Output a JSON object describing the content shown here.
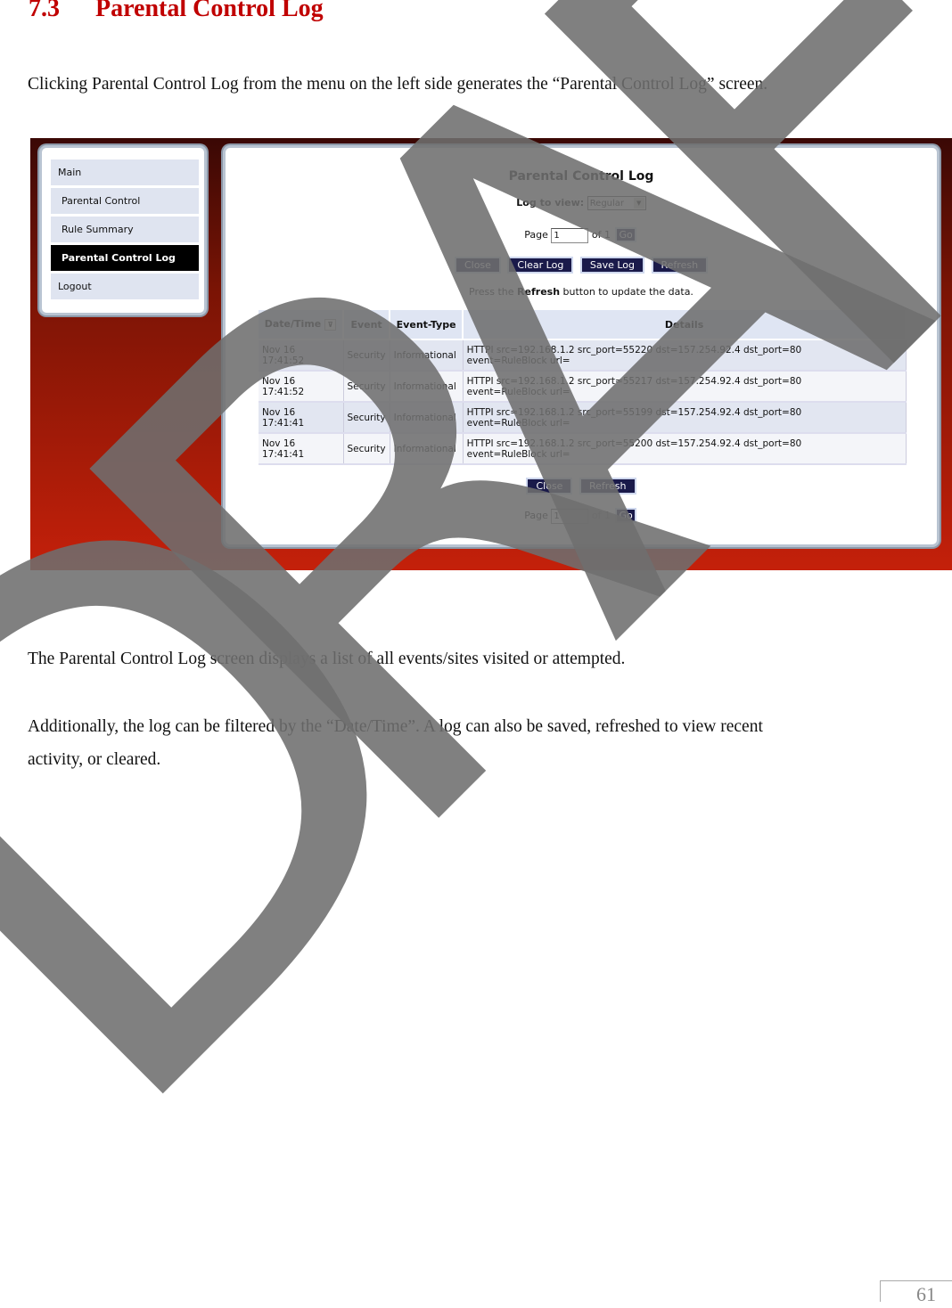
{
  "section": {
    "number": "7.3",
    "title": "Parental Control Log"
  },
  "intro": "Clicking Parental Control Log from the menu on the left side generates the “Parental Control Log” screen.",
  "screenshot": {
    "sidebar": {
      "items": [
        {
          "label": "Main",
          "active": false
        },
        {
          "label": "Parental Control",
          "active": false
        },
        {
          "label": "Rule Summary",
          "active": false
        },
        {
          "label": "Parental Control Log",
          "active": true
        },
        {
          "label": "Logout",
          "active": false
        }
      ]
    },
    "title": "Parental Control Log",
    "log_to_view_label": "Log to view:",
    "log_to_view_value": "Regular",
    "page_label": "Page",
    "page_value": "1",
    "of_label": "of 1",
    "go_label": "Go",
    "buttons": {
      "close": "Close",
      "clear": "Clear Log",
      "save": "Save Log",
      "refresh": "Refresh"
    },
    "hint": {
      "pre": "Press the",
      "bold": "Refresh",
      "post": "button to update the data."
    },
    "columns": [
      "Date/Time",
      "Event",
      "Event-Type",
      "Details"
    ],
    "rows": [
      {
        "date": "Nov 16",
        "time": "17:41:52",
        "event": "Security",
        "type": "Informational",
        "d1": "HTTPI src=192.168.1.2 src_port=55220 dst=157.254.92.4 dst_port=80",
        "d2": "event=RuleBlock url="
      },
      {
        "date": "Nov 16",
        "time": "17:41:52",
        "event": "Security",
        "type": "Informational",
        "d1": "HTTPI src=192.168.1.2 src_port=55217 dst=157.254.92.4 dst_port=80",
        "d2": "event=RuleBlock url="
      },
      {
        "date": "Nov 16",
        "time": "17:41:41",
        "event": "Security",
        "type": "Informational",
        "d1": "HTTPI src=192.168.1.2 src_port=55199 dst=157.254.92.4 dst_port=80",
        "d2": "event=RuleBlock url="
      },
      {
        "date": "Nov 16",
        "time": "17:41:41",
        "event": "Security",
        "type": "Informational",
        "d1": "HTTPI src=192.168.1.2 src_port=55200 dst=157.254.92.4 dst_port=80",
        "d2": "event=RuleBlock url="
      }
    ]
  },
  "body1": "The Parental Control Log screen displays a list of all events/sites visited or attempted.",
  "body2a": "Additionally, the log can be filtered by the “Date/Time”.  A log can also be saved, refreshed to view recent",
  "body2b": "activity, or cleared.",
  "watermark": "DRAFT",
  "page_number": "61",
  "colors": {
    "heading": "#c00000",
    "button": "#1a1a4a",
    "active_menu": "#000000"
  }
}
